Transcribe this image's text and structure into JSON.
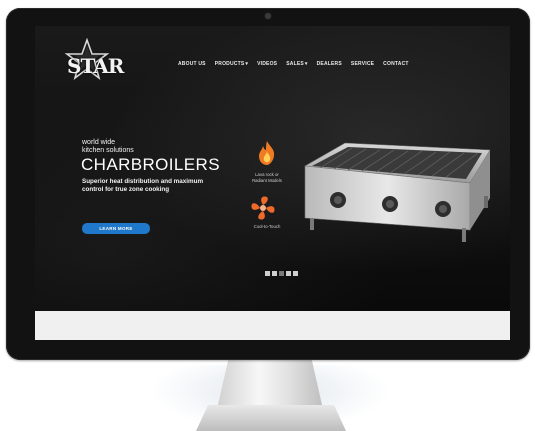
{
  "site": {
    "logo_text": "STAR"
  },
  "nav": {
    "items": [
      {
        "label": "ABOUT US",
        "dropdown": false
      },
      {
        "label": "PRODUCTS",
        "dropdown": true
      },
      {
        "label": "VIDEOS",
        "dropdown": false
      },
      {
        "label": "SALES",
        "dropdown": true
      },
      {
        "label": "DEALERS",
        "dropdown": false
      },
      {
        "label": "SERVICE",
        "dropdown": false
      },
      {
        "label": "CONTACT",
        "dropdown": false
      }
    ],
    "caret": "▾"
  },
  "hero": {
    "tagline_line1": "world wide",
    "tagline_line2": "kitchen solutions",
    "headline": "CHARBROILERS",
    "sub_line1": "Superior heat distribution and maximum",
    "sub_line2": "control for true zone cooking",
    "cta_label": "LEARN MORE"
  },
  "features": {
    "item1_line1": "Lava rock or",
    "item1_line2": "Radiant Models",
    "item2_label": "Cool-to-Touch"
  },
  "slider": {
    "slide_count": 5,
    "active_index": 2
  },
  "colors": {
    "accent_blue": "#1f78c9",
    "flame_orange": "#f07a22",
    "cool_orange": "#ee6a2b"
  }
}
